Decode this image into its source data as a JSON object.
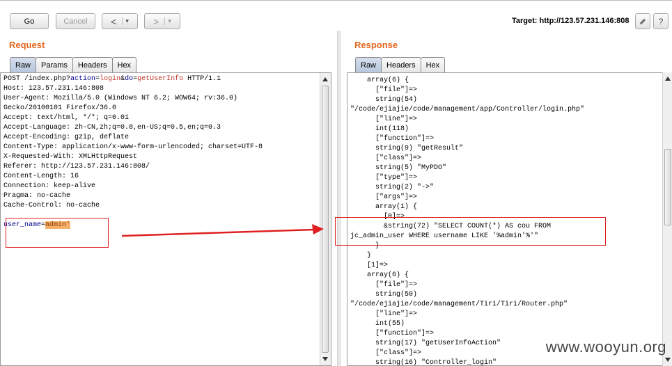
{
  "toolbar": {
    "go_label": "Go",
    "cancel_label": "Cancel",
    "back_label": "<",
    "forward_label": ">",
    "dropdown_glyph": "▾",
    "target_label": "Target: http://123.57.231.146:808",
    "edit_icon": "pencil-icon",
    "help_label": "?"
  },
  "request": {
    "title": "Request",
    "tabs": [
      "Raw",
      "Params",
      "Headers",
      "Hex"
    ],
    "active_tab": "Raw",
    "lines": [
      "Host: 123.57.231.146:808",
      "User-Agent: Mozilla/5.0 (Windows NT 6.2; WOW64; rv:36.0)",
      "Gecko/20100101 Firefox/36.0",
      "Accept: text/html, */*; q=0.01",
      "Accept-Language: zh-CN,zh;q=0.8,en-US;q=0.5,en;q=0.3",
      "Accept-Encoding: gzip, deflate",
      "Content-Type: application/x-www-form-urlencoded; charset=UTF-8",
      "X-Requested-With: XMLHttpRequest",
      "Referer: http://123.57.231.146:808/",
      "Content-Length: 16",
      "Connection: keep-alive",
      "Pragma: no-cache",
      "Cache-Control: no-cache"
    ],
    "first_line": {
      "method_path": "POST /index.php?",
      "p1_name": "action",
      "p1_value": "login",
      "amp": "&",
      "p2_name": "do",
      "p2_value": "getUserInfo",
      "version": " HTTP/1.1"
    },
    "body": {
      "param_name": "user_name",
      "eq": "=",
      "param_value": "admin'"
    }
  },
  "response": {
    "title": "Response",
    "tabs": [
      "Raw",
      "Headers",
      "Hex"
    ],
    "active_tab": "Raw",
    "lines": [
      "    array(6) {",
      "      [\"file\"]=>",
      "      string(54)",
      "\"/code/ejiajie/code/management/app/Controller/login.php\"",
      "      [\"line\"]=>",
      "      int(118)",
      "      [\"function\"]=>",
      "      string(9) \"getResult\"",
      "      [\"class\"]=>",
      "      string(5) \"MyPDO\"",
      "      [\"type\"]=>",
      "      string(2) \"->\"",
      "      [\"args\"]=>",
      "      array(1) {",
      "        [0]=>",
      "        &string(72) \"SELECT COUNT(*) AS cou FROM",
      "jc_admin_user WHERE username LIKE '%admin'%'\"",
      "      }",
      "    }",
      "    [1]=>",
      "    array(6) {",
      "      [\"file\"]=>",
      "      string(50)",
      "\"/code/ejiajie/code/management/Tiri/Tiri/Router.php\"",
      "      [\"line\"]=>",
      "      int(55)",
      "      [\"function\"]=>",
      "      string(17) \"getUserInfoAction\"",
      "      [\"class\"]=>",
      "      string(16) \"Controller_login\""
    ]
  },
  "watermark": "www.wooyun.org",
  "colors": {
    "accent": "#e5671e",
    "highlight": "#f6b06a",
    "annotation": "#e02020",
    "param": "#00008b"
  }
}
